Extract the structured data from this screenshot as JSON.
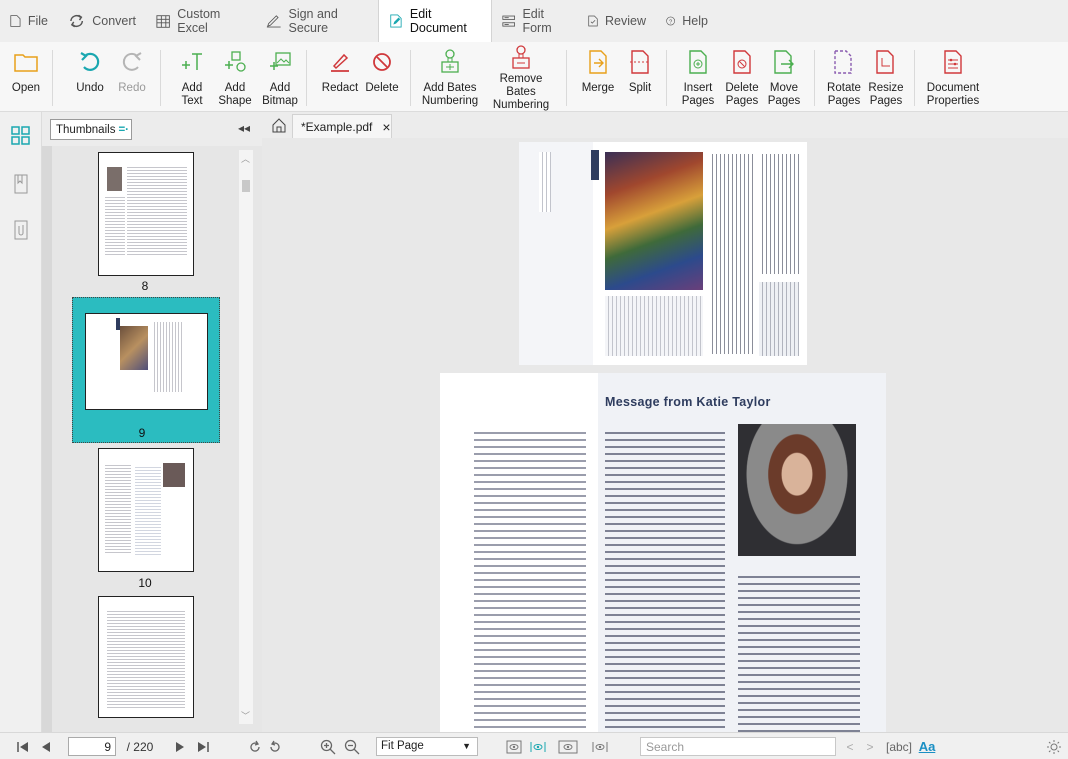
{
  "menu": {
    "tabs": [
      {
        "label": "File",
        "icon": "file-icon"
      },
      {
        "label": "Convert",
        "icon": "convert-icon"
      },
      {
        "label": "Custom Excel",
        "icon": "table-icon"
      },
      {
        "label": "Sign and Secure",
        "icon": "pen-icon"
      },
      {
        "label": "Edit Document",
        "icon": "edit-document-icon",
        "active": true
      },
      {
        "label": "Edit Form",
        "icon": "form-icon"
      },
      {
        "label": "Review",
        "icon": "review-icon"
      },
      {
        "label": "Help",
        "icon": "help-icon"
      }
    ]
  },
  "ribbon": {
    "open": "Open",
    "undo": "Undo",
    "redo": "Redo",
    "add_text": "Add\nText",
    "add_shape": "Add\nShape",
    "add_bitmap": "Add\nBitmap",
    "redact": "Redact",
    "delete": "Delete",
    "add_bates": "Add Bates\nNumbering",
    "remove_bates": "Remove Bates\nNumbering",
    "merge": "Merge",
    "split": "Split",
    "insert_pages": "Insert\nPages",
    "delete_pages": "Delete\nPages",
    "move_pages": "Move\nPages",
    "rotate_pages": "Rotate\nPages",
    "resize_pages": "Resize\nPages",
    "doc_props": "Document\nProperties"
  },
  "thumbnails": {
    "dropdown_label": "Thumbnails",
    "pages": [
      "8",
      "9",
      "10"
    ],
    "selected": "9"
  },
  "document": {
    "tab_title": "*Example.pdf",
    "close_glyph": "×",
    "page_heading": "Message from Katie Taylor"
  },
  "bottom": {
    "current_page": "9",
    "total_pages": "/ 220",
    "zoom": "Fit Page",
    "search_placeholder": "Search",
    "abc": "[abc]",
    "aa": "Aa"
  },
  "colors": {
    "accent_teal": "#2bbcc0",
    "icon_orange": "#e8a01a",
    "icon_green": "#4caf50",
    "icon_red": "#d0383b",
    "icon_purple": "#8a5bb0",
    "title_navy": "#2e3c5e"
  }
}
